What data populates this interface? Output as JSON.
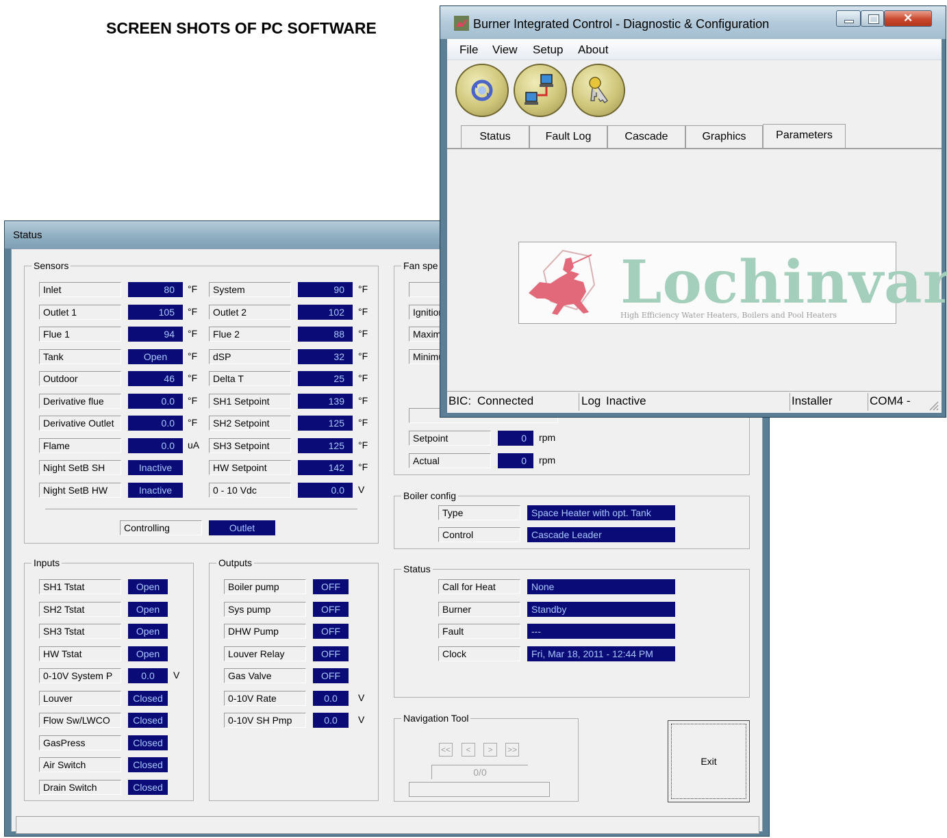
{
  "heading": "SCREEN SHOTS OF PC SOFTWARE",
  "status_window": {
    "title": "Status",
    "sensors": {
      "title": "Sensors",
      "left": [
        {
          "label": "Inlet",
          "value": "80",
          "unit": "°F"
        },
        {
          "label": "Outlet 1",
          "value": "105",
          "unit": "°F"
        },
        {
          "label": "Flue 1",
          "value": "94",
          "unit": "°F"
        },
        {
          "label": "Tank",
          "value": "Open",
          "unit": "°F"
        },
        {
          "label": "Outdoor",
          "value": "46",
          "unit": "°F"
        },
        {
          "label": "Derivative flue",
          "value": "0.0",
          "unit": "°F"
        },
        {
          "label": "Derivative Outlet",
          "value": "0.0",
          "unit": "°F"
        },
        {
          "label": "Flame",
          "value": "0.0",
          "unit": "uA"
        },
        {
          "label": "Night SetB SH",
          "value": "Inactive",
          "unit": ""
        },
        {
          "label": "Night SetB HW",
          "value": "Inactive",
          "unit": ""
        }
      ],
      "right": [
        {
          "label": "System",
          "value": "90",
          "unit": "°F"
        },
        {
          "label": "Outlet 2",
          "value": "102",
          "unit": "°F"
        },
        {
          "label": "Flue 2",
          "value": "88",
          "unit": "°F"
        },
        {
          "label": "dSP",
          "value": "32",
          "unit": "°F"
        },
        {
          "label": "Delta T",
          "value": "25",
          "unit": "°F"
        },
        {
          "label": "SH1 Setpoint",
          "value": "139",
          "unit": "°F"
        },
        {
          "label": "SH2 Setpoint",
          "value": "125",
          "unit": "°F"
        },
        {
          "label": "SH3 Setpoint",
          "value": "125",
          "unit": "°F"
        },
        {
          "label": "HW Setpoint",
          "value": "142",
          "unit": "°F"
        },
        {
          "label": "0 - 10 Vdc",
          "value": "0.0",
          "unit": "V"
        }
      ],
      "controlling_label": "Controlling",
      "controlling_value": "Outlet"
    },
    "inputs": {
      "title": "Inputs",
      "items": [
        {
          "label": "SH1 Tstat",
          "value": "Open",
          "unit": ""
        },
        {
          "label": "SH2 Tstat",
          "value": "Open",
          "unit": ""
        },
        {
          "label": "SH3 Tstat",
          "value": "Open",
          "unit": ""
        },
        {
          "label": "HW Tstat",
          "value": "Open",
          "unit": ""
        },
        {
          "label": "0-10V System P",
          "value": "0.0",
          "unit": "V"
        },
        {
          "label": "Louver",
          "value": "Closed",
          "unit": ""
        },
        {
          "label": "Flow Sw/LWCO",
          "value": "Closed",
          "unit": ""
        },
        {
          "label": "GasPress",
          "value": "Closed",
          "unit": ""
        },
        {
          "label": "Air Switch",
          "value": "Closed",
          "unit": ""
        },
        {
          "label": "Drain Switch",
          "value": "Closed",
          "unit": ""
        }
      ]
    },
    "outputs": {
      "title": "Outputs",
      "items": [
        {
          "label": "Boiler pump",
          "value": "OFF",
          "unit": ""
        },
        {
          "label": "Sys pump",
          "value": "OFF",
          "unit": ""
        },
        {
          "label": "DHW Pump",
          "value": "OFF",
          "unit": ""
        },
        {
          "label": "Louver Relay",
          "value": "OFF",
          "unit": ""
        },
        {
          "label": "Gas Valve",
          "value": "OFF",
          "unit": ""
        },
        {
          "label": "0-10V Rate",
          "value": "0.0",
          "unit": "V"
        },
        {
          "label": "0-10V SH Pmp",
          "value": "0.0",
          "unit": "V"
        }
      ]
    },
    "fan": {
      "title": "Fan spe",
      "rows": [
        "Ignitior",
        "Maxim",
        "Minimu"
      ],
      "setpoint_label": "Setpoint",
      "setpoint_value": "0",
      "setpoint_unit": "rpm",
      "actual_label": "Actual",
      "actual_value": "0",
      "actual_unit": "rpm"
    },
    "boiler_config": {
      "title": "Boiler config",
      "type_label": "Type",
      "type_value": "Space Heater with opt. Tank",
      "control_label": "Control",
      "control_value": "Cascade Leader"
    },
    "status_group": {
      "title": "Status",
      "items": [
        {
          "label": "Call for Heat",
          "value": "None"
        },
        {
          "label": "Burner",
          "value": "Standby"
        },
        {
          "label": "Fault",
          "value": "---"
        },
        {
          "label": "Clock",
          "value": "Fri, Mar 18, 2011 - 12:44 PM"
        }
      ]
    },
    "navigation": {
      "title": "Navigation Tool",
      "first": "<<",
      "prev": "<",
      "next": ">",
      "last": ">>",
      "counter": "0/0"
    },
    "exit_label": "Exit"
  },
  "bic_window": {
    "title": "Burner Integrated Control - Diagnostic & Configuration",
    "menu": [
      "File",
      "View",
      "Setup",
      "About"
    ],
    "tabs": [
      "Status",
      "Fault Log",
      "Cascade",
      "Graphics",
      "Parameters"
    ],
    "logo_word": "Lochinvar",
    "logo_tagline": "High Efficiency Water Heaters, Boilers and Pool Heaters",
    "statusbar": {
      "bic_label": "BIC:",
      "bic_state": "Connected",
      "log_label": "Log",
      "log_state": "Inactive",
      "user": "Installer",
      "port": "COM4 -"
    }
  },
  "colors": {
    "value_bg": "#0b0b78",
    "value_text": "#a8c8ff",
    "window_frame": "#5a7f95",
    "logo_green": "#a5cfbd",
    "logo_horse": "#e2697a"
  }
}
